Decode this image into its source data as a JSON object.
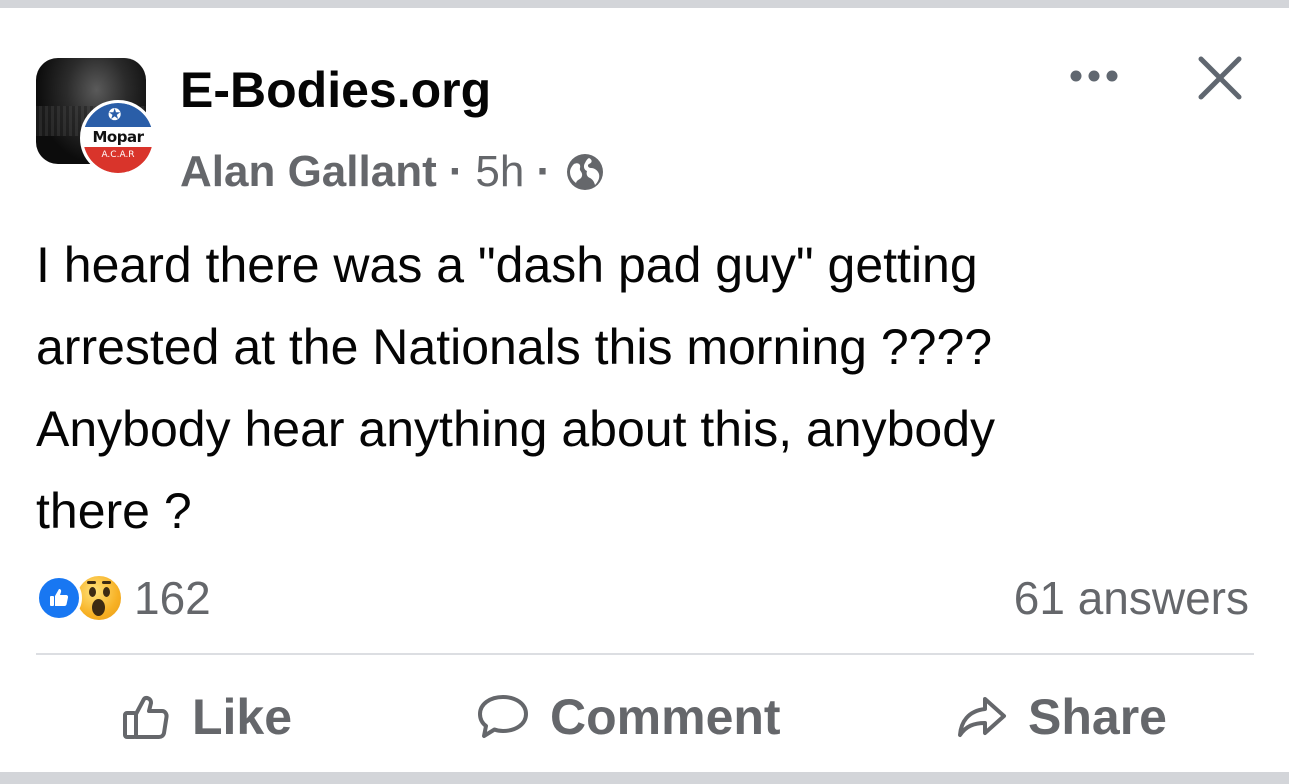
{
  "post": {
    "group_name": "E-Bodies.org",
    "author": "Alan Gallant",
    "time": "5h",
    "separator": "·",
    "avatar": {
      "badge_text": "Mopar",
      "badge_sub": "A.C.A.R"
    },
    "icons": {
      "privacy": "globe-icon",
      "more": "more-options-icon",
      "close": "close-icon"
    },
    "text_lines": [
      "I heard there was a \"dash pad guy\" getting",
      "arrested at the Nationals this morning ????",
      "Anybody hear anything about this, anybody",
      "there ?"
    ]
  },
  "stats": {
    "reaction_count": "162",
    "reaction_types": [
      "like",
      "wow"
    ],
    "answers": "61 answers"
  },
  "actions": {
    "like_label": "Like",
    "comment_label": "Comment",
    "share_label": "Share"
  },
  "colors": {
    "primary_text": "#050505",
    "secondary_text": "#65676b",
    "like_blue": "#1877f2",
    "divider": "#dcdee2"
  }
}
